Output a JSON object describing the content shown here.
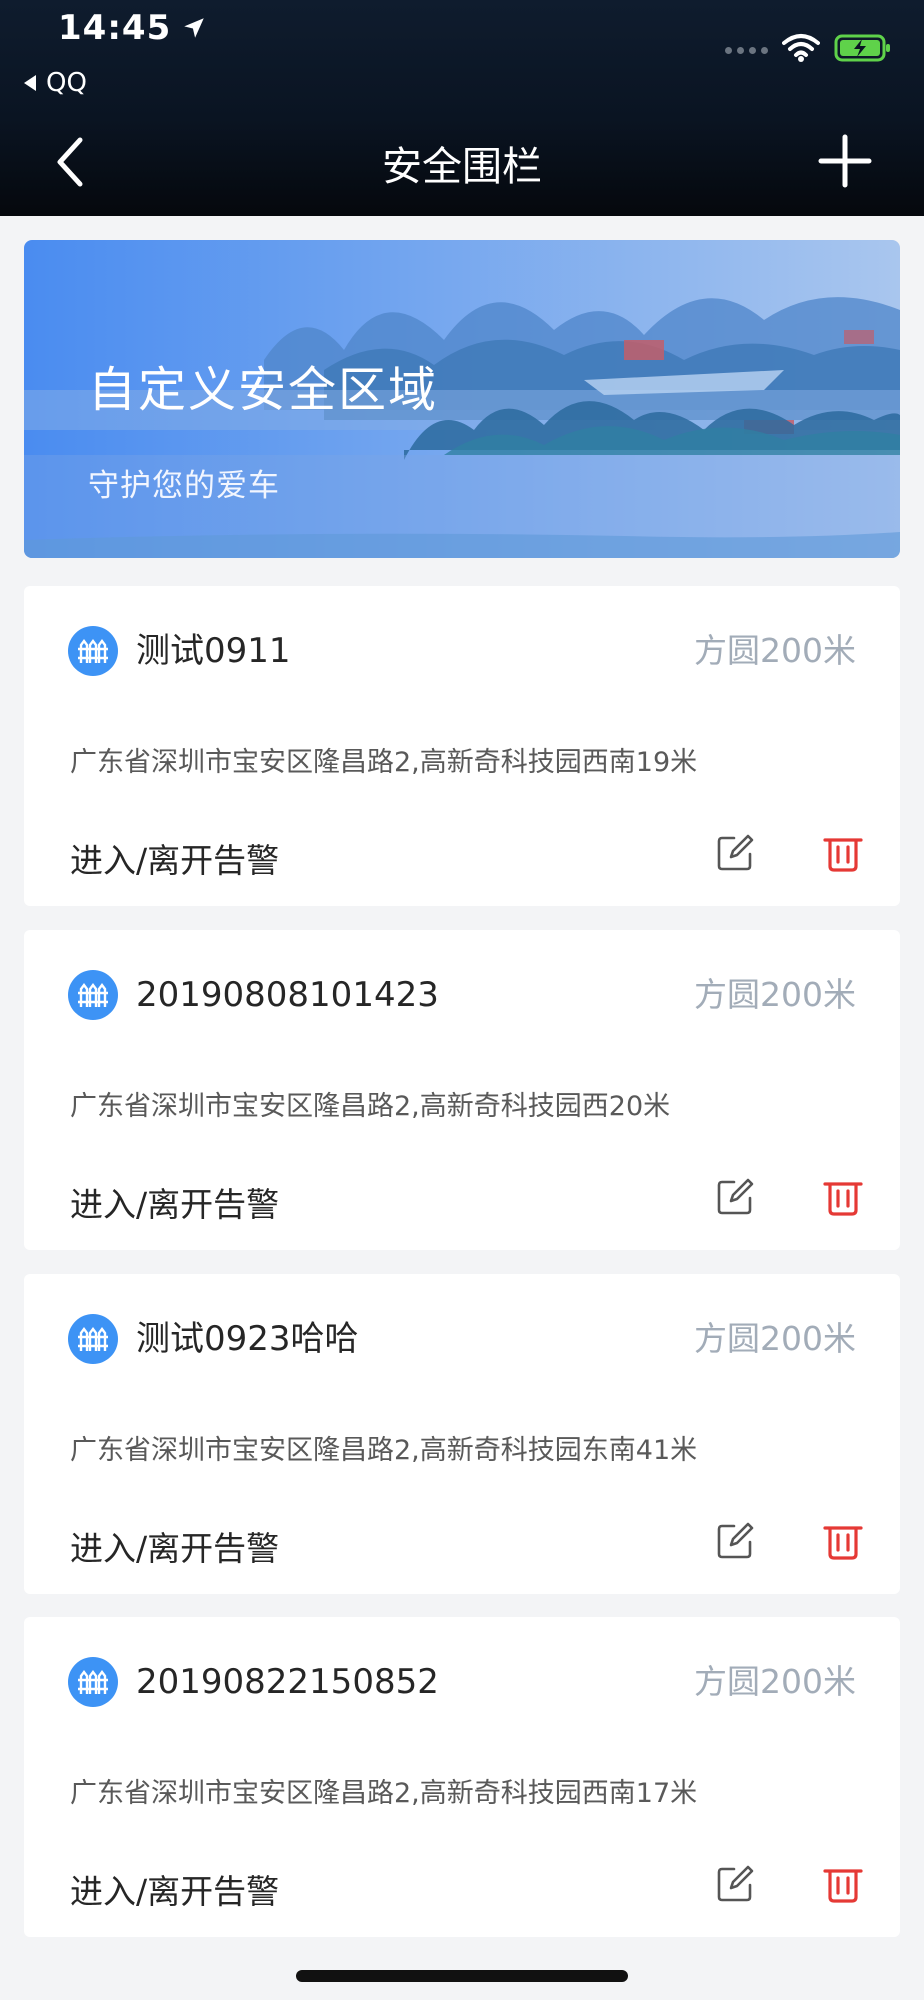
{
  "status_bar": {
    "time": "14:45",
    "back_app": "QQ"
  },
  "nav": {
    "title": "安全围栏"
  },
  "banner": {
    "title": "自定义安全区域",
    "subtitle": "守护您的爱车"
  },
  "fences": [
    {
      "name": "测试0911",
      "radius": "方圆200米",
      "address": "广东省深圳市宝安区隆昌路2,高新奇科技园西南19米",
      "alert": "进入/离开告警"
    },
    {
      "name": "20190808101423",
      "radius": "方圆200米",
      "address": "广东省深圳市宝安区隆昌路2,高新奇科技园西20米",
      "alert": "进入/离开告警"
    },
    {
      "name": "测试0923哈哈",
      "radius": "方圆200米",
      "address": "广东省深圳市宝安区隆昌路2,高新奇科技园东南41米",
      "alert": "进入/离开告警"
    },
    {
      "name": "20190822150852",
      "radius": "方圆200米",
      "address": "广东省深圳市宝安区隆昌路2,高新奇科技园西南17米",
      "alert": "进入/离开告警"
    }
  ],
  "icons": {
    "fence": "fence-icon",
    "edit": "edit-icon",
    "delete": "trash-icon",
    "add": "plus-icon",
    "back": "chevron-left-icon"
  },
  "colors": {
    "accent": "#3d93f5",
    "delete": "#e53935",
    "muted": "#a2acb8"
  }
}
